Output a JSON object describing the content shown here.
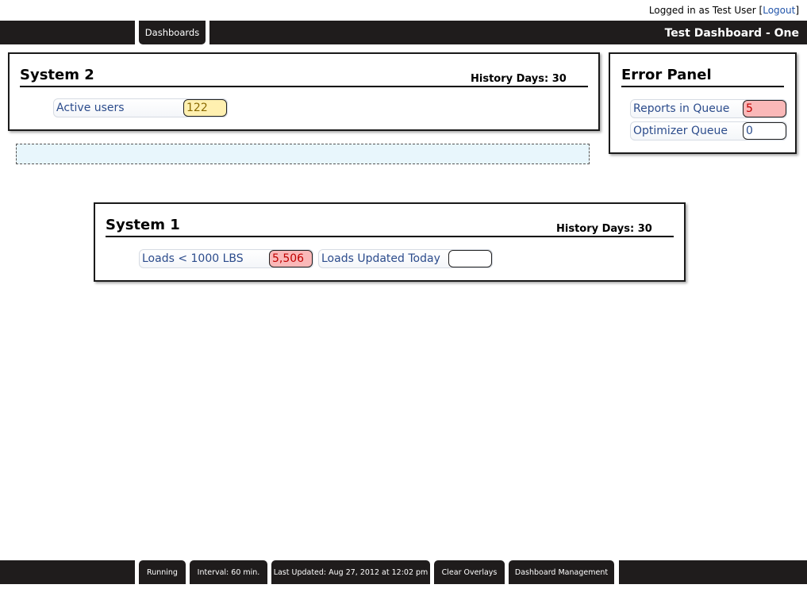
{
  "header": {
    "logged_in_prefix": "Logged in as Test User [",
    "logout_label": "Logout",
    "logged_in_suffix": "]",
    "dashboards_tab": "Dashboards",
    "dashboard_title": "Test Dashboard - One"
  },
  "system2": {
    "title": "System 2",
    "history": "History Days: 30",
    "metrics": [
      {
        "label": "Active users",
        "value": "122",
        "status": "warning"
      }
    ]
  },
  "error_panel": {
    "title": "Error Panel",
    "metrics": [
      {
        "label": "Reports in Queue",
        "value": "5",
        "status": "error"
      },
      {
        "label": "Optimizer Queue",
        "value": "0",
        "status": "normal"
      }
    ]
  },
  "system1": {
    "title": "System 1",
    "history": "History Days: 30",
    "metrics": [
      {
        "label": "Loads < 1000 LBS",
        "value": "5,506",
        "status": "error"
      },
      {
        "label": "Loads Updated Today",
        "value": "",
        "status": "normal"
      }
    ]
  },
  "footer": {
    "running": "Running",
    "interval": "Interval: 60 min.",
    "last_updated": "Last Updated: Aug 27, 2012 at 12:02 pm",
    "clear_overlays": "Clear Overlays",
    "dashboard_management": "Dashboard Management"
  },
  "colors": {
    "bar_bg": "#1f1c1c",
    "warning_bg": "#fff0b0",
    "error_bg": "#fab8b8",
    "label_text": "#2c4c8c",
    "dropzone_bg": "#e8f6fc"
  }
}
